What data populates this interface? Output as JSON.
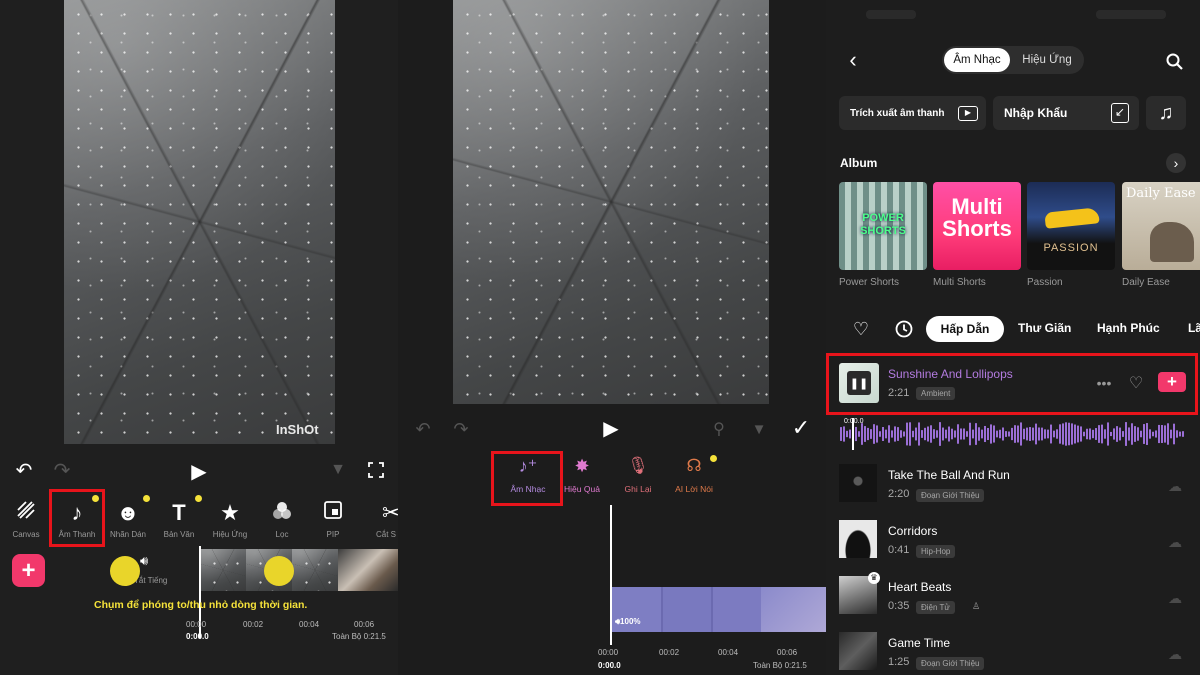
{
  "left_panel": {
    "watermark": "InShOt",
    "tools": [
      {
        "label": "Canvas",
        "icon": "canvas-icon"
      },
      {
        "label": "Âm Thanh",
        "icon": "music-note-icon"
      },
      {
        "label": "Nhãn Dán",
        "icon": "sticker-icon"
      },
      {
        "label": "Bản Văn",
        "icon": "text-icon"
      },
      {
        "label": "Hiệu Ứng",
        "icon": "star-icon"
      },
      {
        "label": "Lọc",
        "icon": "filter-icon"
      },
      {
        "label": "PIP",
        "icon": "pip-icon"
      },
      {
        "label": "Cắt S",
        "icon": "scissors-icon"
      }
    ],
    "mute_label": "Tắt Tiếng",
    "hint": "Chụm để phóng to/thu nhỏ dòng thời gian.",
    "current_time": "0:00.0",
    "ticks": [
      "00:02",
      "00:04",
      "00:06"
    ],
    "total": "Toàn Bộ 0:21.5"
  },
  "middle_panel": {
    "audio_tools": [
      {
        "label": "Âm Nhạc",
        "icon": "music-add-icon",
        "color": "#b48be0"
      },
      {
        "label": "Hiệu Quả",
        "icon": "sparkle-icon",
        "color": "#e07ad0"
      },
      {
        "label": "Ghi Lại",
        "icon": "mic-icon",
        "color": "#e0707a"
      },
      {
        "label": "AI Lời Nói",
        "icon": "ai-voice-icon",
        "color": "#e07a4a"
      }
    ],
    "volume": "100%",
    "current_time": "00:00",
    "current_time_precise": "0:00.0",
    "ticks": [
      "00:02",
      "00:04",
      "00:06"
    ],
    "total": "Toàn Bộ 0:21.5"
  },
  "right_panel": {
    "tabs": [
      "Âm Nhạc",
      "Hiệu Ứng"
    ],
    "active_tab": "Âm Nhạc",
    "extract_label": "Trích xuất âm thanh",
    "import_label": "Nhập Khẩu",
    "album_heading": "Album",
    "albums": [
      {
        "name": "Power Shorts",
        "art_text": "POWER SHORTS"
      },
      {
        "name": "Multi Shorts",
        "art_text": "Multi Shorts"
      },
      {
        "name": "Passion",
        "art_text": "PASSION"
      },
      {
        "name": "Daily Ease",
        "art_text": "Daily Ease"
      }
    ],
    "mood_tabs": [
      "Hấp Dẫn",
      "Thư Giãn",
      "Hạnh Phúc",
      "Lã"
    ],
    "active_mood": "Hấp Dẫn",
    "tracks": [
      {
        "title": "Sunshine And Lollipops",
        "duration": "2:21",
        "tag": "Ambient",
        "playing": true
      },
      {
        "title": "Take The Ball And Run",
        "duration": "2:20",
        "tag": "Đoạn Giới Thiệu"
      },
      {
        "title": "Corridors",
        "duration": "0:41",
        "tag": "Hip-Hop"
      },
      {
        "title": "Heart Beats",
        "duration": "0:35",
        "tag": "Điện Tử"
      },
      {
        "title": "Game Time",
        "duration": "1:25",
        "tag": "Đoạn Giới Thiệu"
      }
    ],
    "waveform_time": "0:00.0"
  },
  "colors": {
    "accent_pink": "#f2386b",
    "highlight_red": "#e8141b",
    "playing_title": "#b37be0",
    "waveform": "#9b6fd6",
    "yellow_dot": "#f5e23a"
  }
}
